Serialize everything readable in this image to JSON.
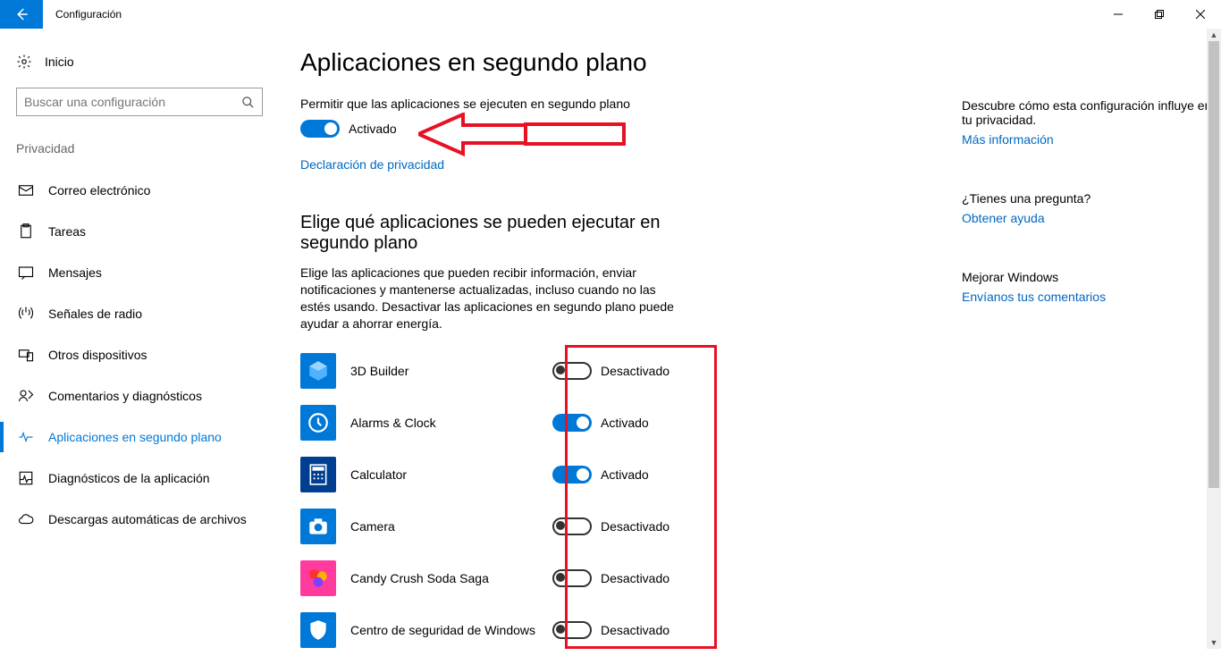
{
  "window": {
    "title": "Configuración"
  },
  "sidebar": {
    "home": "Inicio",
    "search_placeholder": "Buscar una configuración",
    "section": "Privacidad",
    "items": [
      {
        "label": "Correo electrónico",
        "icon": "mail"
      },
      {
        "label": "Tareas",
        "icon": "clipboard"
      },
      {
        "label": "Mensajes",
        "icon": "message"
      },
      {
        "label": "Señales de radio",
        "icon": "radio"
      },
      {
        "label": "Otros dispositivos",
        "icon": "devices"
      },
      {
        "label": "Comentarios y diagnósticos",
        "icon": "feedback"
      },
      {
        "label": "Aplicaciones en segundo plano",
        "icon": "heartbeat",
        "active": true
      },
      {
        "label": "Diagnósticos de la aplicación",
        "icon": "diag"
      },
      {
        "label": "Descargas automáticas de archivos",
        "icon": "cloud"
      }
    ]
  },
  "main": {
    "heading": "Aplicaciones en segundo plano",
    "allow_label": "Permitir que las aplicaciones se ejecuten en segundo plano",
    "master_state": "Activado",
    "master_on": true,
    "privacy_link": "Declaración de privacidad",
    "subheading": "Elige qué aplicaciones se pueden ejecutar en segundo plano",
    "description": "Elige las aplicaciones que pueden recibir información, enviar notificaciones y mantenerse actualizadas, incluso cuando no las estés usando. Desactivar las aplicaciones en segundo plano puede ayudar a ahorrar energía.",
    "on_label": "Activado",
    "off_label": "Desactivado",
    "apps": [
      {
        "name": "3D Builder",
        "on": false,
        "state": "Desactivado",
        "bg": "#0078d7",
        "glyph": "cube"
      },
      {
        "name": "Alarms & Clock",
        "on": true,
        "state": "Activado",
        "bg": "#0078d7",
        "glyph": "clock"
      },
      {
        "name": "Calculator",
        "on": true,
        "state": "Activado",
        "bg": "#003e92",
        "glyph": "calc"
      },
      {
        "name": "Camera",
        "on": false,
        "state": "Desactivado",
        "bg": "#0078d7",
        "glyph": "camera"
      },
      {
        "name": "Candy Crush Soda Saga",
        "on": false,
        "state": "Desactivado",
        "bg": "#ff3b9e",
        "glyph": "candy"
      },
      {
        "name": "Centro de seguridad de Windows D...",
        "on": false,
        "state": "Desactivado",
        "bg": "#0078d7",
        "glyph": "shield"
      }
    ]
  },
  "right": {
    "privacy_text": "Descubre cómo esta configuración influye en tu privacidad.",
    "privacy_link": "Más información",
    "question": "¿Tienes una pregunta?",
    "help_link": "Obtener ayuda",
    "improve": "Mejorar Windows",
    "feedback_link": "Envíanos tus comentarios"
  }
}
